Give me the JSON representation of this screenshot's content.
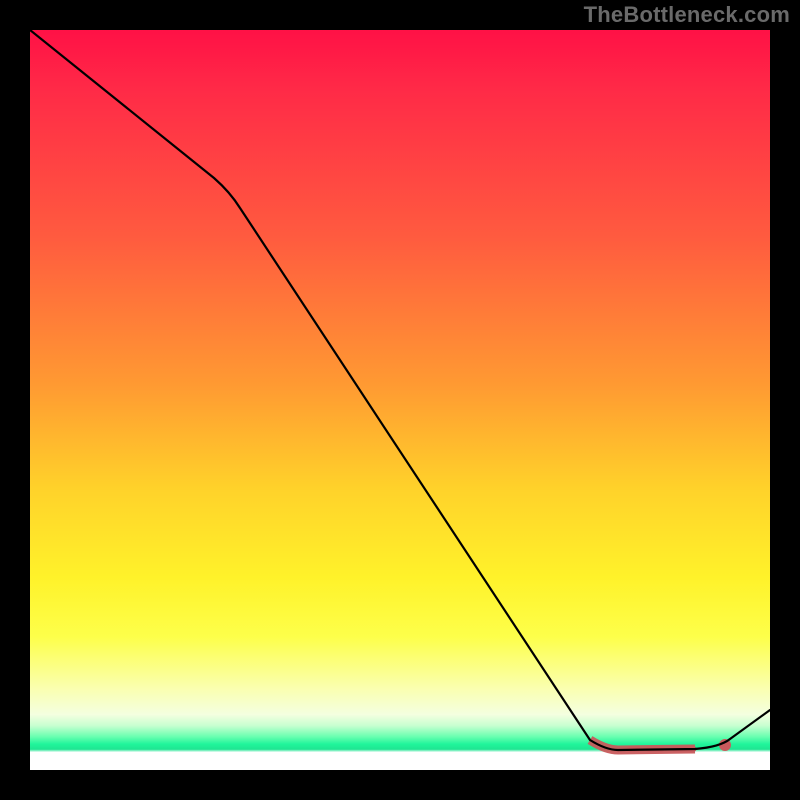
{
  "watermark": "TheBottleneck.com",
  "chart_data": {
    "type": "line",
    "title": "",
    "xlabel": "",
    "ylabel": "",
    "xlim": [
      0,
      100
    ],
    "ylim": [
      0,
      100
    ],
    "x": [
      0,
      25,
      76,
      80,
      90,
      94,
      100
    ],
    "values": [
      100,
      80,
      4,
      1,
      0.5,
      1,
      5
    ],
    "highlight_range_x": [
      76,
      94
    ],
    "colors": {
      "line": "#000000",
      "highlight": "#c85a5c",
      "gradient_top": "#ff1146",
      "gradient_mid": "#fff22a",
      "gradient_bottom": "#20f59b"
    }
  }
}
